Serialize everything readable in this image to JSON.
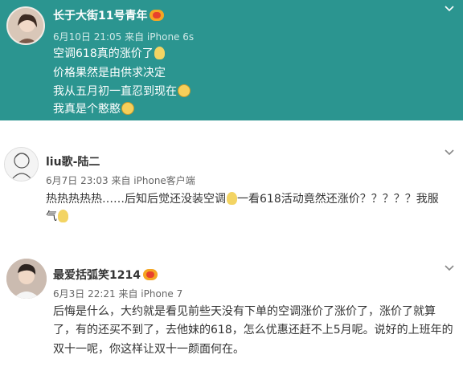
{
  "posts": [
    {
      "username": "长于大街11号青年",
      "meta": "6月10日 21:05 来自 iPhone 6s",
      "lines": [
        "空调618真的涨价了",
        "价格果然是由供求决定",
        "我从五月初一直忍到现在",
        "我真是个憨憨"
      ],
      "has_vip_badge": true
    },
    {
      "username": "liu歌-陆二",
      "meta": "6月7日 23:03 来自 iPhone客户端",
      "lines": [
        "热热热热热……后知后觉还没装空调",
        "一看618活动竟然还涨价？？？？？我服",
        "气"
      ]
    },
    {
      "username": "最爱括弧笑1214",
      "meta": "6月3日 22:21 来自 iPhone 7",
      "lines": [
        "后悔是什么，大约就是看见前些天没有下单的空调涨价了涨价了，涨价了就算",
        "了，有的还买不到了，去他妹的618，怎么优惠还赶不上5月呢。说好的上班年的",
        "双十一呢，你这样让双十一颜面何在。"
      ],
      "has_vip_badge": true
    }
  ],
  "icons": {
    "expand": "chevron-down-icon",
    "bulb": "light-bulb-emoji",
    "face": "embarrassed-face-emoji"
  },
  "colors": {
    "highlight_background": "#2b9590",
    "text": "#333333",
    "meta": "#666666"
  }
}
